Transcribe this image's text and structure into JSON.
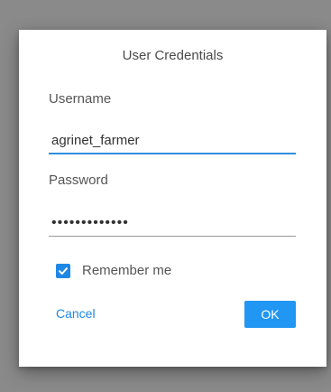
{
  "dialog": {
    "title": "User Credentials",
    "username": {
      "label": "Username",
      "value": "agrinet_farmer"
    },
    "password": {
      "label": "Password",
      "value": "•••••••••••••"
    },
    "remember": {
      "label": "Remember me",
      "checked": true
    },
    "buttons": {
      "cancel_label": "Cancel",
      "ok_label": "OK"
    }
  },
  "colors": {
    "accent": "#2196f3",
    "backdrop": "#8a8a8a"
  },
  "icons": {
    "checkbox": "check-icon"
  }
}
